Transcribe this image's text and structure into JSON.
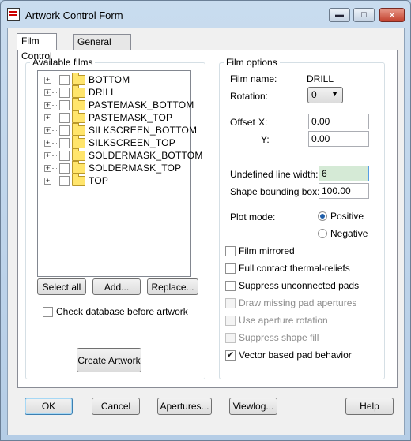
{
  "window": {
    "title": "Artwork Control Form",
    "min_glyph": "▬",
    "max_glyph": "□",
    "close_glyph": "✕"
  },
  "tabs": [
    {
      "label": "Film Control",
      "active": true
    },
    {
      "label": "General Parameters",
      "active": false
    }
  ],
  "films": {
    "group_label": "Available films",
    "items": [
      {
        "label": "BOTTOM",
        "checked": false
      },
      {
        "label": "DRILL",
        "checked": false
      },
      {
        "label": "PASTEMASK_BOTTOM",
        "checked": false
      },
      {
        "label": "PASTEMASK_TOP",
        "checked": false
      },
      {
        "label": "SILKSCREEN_BOTTOM",
        "checked": false
      },
      {
        "label": "SILKSCREEN_TOP",
        "checked": false
      },
      {
        "label": "SOLDERMASK_BOTTOM",
        "checked": false
      },
      {
        "label": "SOLDERMASK_TOP",
        "checked": false
      },
      {
        "label": "TOP",
        "checked": false
      }
    ],
    "select_all": "Select all",
    "add": "Add...",
    "replace": "Replace...",
    "check_database": "Check database before artwork",
    "create_artwork": "Create Artwork"
  },
  "options": {
    "group_label": "Film options",
    "film_name_label": "Film name:",
    "film_name_value": "DRILL",
    "rotation_label": "Rotation:",
    "rotation_value": "0",
    "offset_label": "Offset",
    "x_label": "X:",
    "x_value": "0.00",
    "y_label": "Y:",
    "y_value": "0.00",
    "undefined_line_width_label": "Undefined line width:",
    "undefined_line_width_value": "6",
    "shape_bounding_box_label": "Shape bounding box:",
    "shape_bounding_box_value": "100.00",
    "plot_mode_label": "Plot mode:",
    "positive_label": "Positive",
    "negative_label": "Negative",
    "plot_mode": "Positive",
    "checkboxes": {
      "film_mirrored": "Film mirrored",
      "full_contact": "Full contact thermal-reliefs",
      "suppress_unconnected": "Suppress unconnected pads",
      "draw_missing": "Draw missing pad apertures",
      "use_aperture_rotation": "Use aperture rotation",
      "suppress_shape_fill": "Suppress shape fill",
      "vector_based": "Vector based pad behavior"
    }
  },
  "footer": {
    "ok": "OK",
    "cancel": "Cancel",
    "apertures": "Apertures...",
    "viewlog": "Viewlog...",
    "help": "Help"
  }
}
